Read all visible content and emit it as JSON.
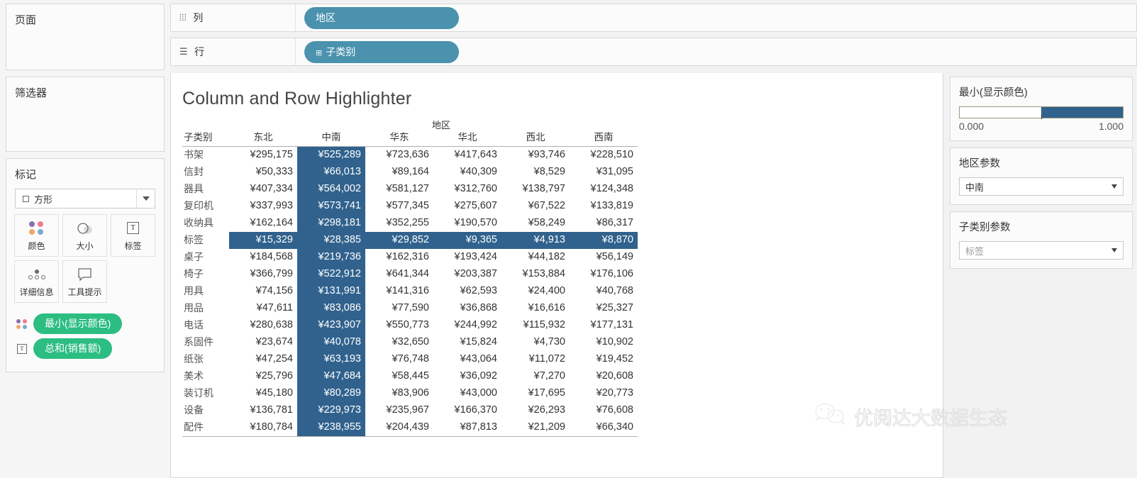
{
  "left_panel": {
    "pages_title": "页面",
    "filters_title": "筛选器",
    "marks_title": "标记",
    "mark_type": "方形",
    "mark_buttons": [
      {
        "label": "颜色",
        "icon": "color-dots-icon"
      },
      {
        "label": "大小",
        "icon": "size-icon"
      },
      {
        "label": "标签",
        "icon": "label-text-icon"
      },
      {
        "label": "详细信息",
        "icon": "detail-dots-icon"
      },
      {
        "label": "工具提示",
        "icon": "tooltip-icon"
      }
    ],
    "mark_pills": [
      {
        "label": "最小(显示颜色)",
        "icon": "color-dots-icon"
      },
      {
        "label": "总和(销售额)",
        "icon": "label-text-icon"
      }
    ]
  },
  "shelves": [
    {
      "name": "columns",
      "label": "列",
      "icon": "columns-icon",
      "pill": "地区",
      "has_expand": false
    },
    {
      "name": "rows",
      "label": "行",
      "icon": "rows-icon",
      "pill": "子类别",
      "has_expand": true
    }
  ],
  "viz": {
    "title": "Column and Row Highlighter",
    "field_header": "地区",
    "row_header": "子类别",
    "columns": [
      "东北",
      "中南",
      "华东",
      "华北",
      "西北",
      "西南"
    ],
    "highlighted_column": "中南",
    "highlighted_row": "标签",
    "rows": [
      {
        "label": "书架",
        "values": [
          "¥295,175",
          "¥525,289",
          "¥723,636",
          "¥417,643",
          "¥93,746",
          "¥228,510"
        ]
      },
      {
        "label": "信封",
        "values": [
          "¥50,333",
          "¥66,013",
          "¥89,164",
          "¥40,309",
          "¥8,529",
          "¥31,095"
        ]
      },
      {
        "label": "器具",
        "values": [
          "¥407,334",
          "¥564,002",
          "¥581,127",
          "¥312,760",
          "¥138,797",
          "¥124,348"
        ]
      },
      {
        "label": "复印机",
        "values": [
          "¥337,993",
          "¥573,741",
          "¥577,345",
          "¥275,607",
          "¥67,522",
          "¥133,819"
        ]
      },
      {
        "label": "收纳具",
        "values": [
          "¥162,164",
          "¥298,181",
          "¥352,255",
          "¥190,570",
          "¥58,249",
          "¥86,317"
        ]
      },
      {
        "label": "标签",
        "values": [
          "¥15,329",
          "¥28,385",
          "¥29,852",
          "¥9,365",
          "¥4,913",
          "¥8,870"
        ]
      },
      {
        "label": "桌子",
        "values": [
          "¥184,568",
          "¥219,736",
          "¥162,316",
          "¥193,424",
          "¥44,182",
          "¥56,149"
        ]
      },
      {
        "label": "椅子",
        "values": [
          "¥366,799",
          "¥522,912",
          "¥641,344",
          "¥203,387",
          "¥153,884",
          "¥176,106"
        ]
      },
      {
        "label": "用具",
        "values": [
          "¥74,156",
          "¥131,991",
          "¥141,316",
          "¥62,593",
          "¥24,400",
          "¥40,768"
        ]
      },
      {
        "label": "用品",
        "values": [
          "¥47,611",
          "¥83,086",
          "¥77,590",
          "¥36,868",
          "¥16,616",
          "¥25,327"
        ]
      },
      {
        "label": "电话",
        "values": [
          "¥280,638",
          "¥423,907",
          "¥550,773",
          "¥244,992",
          "¥115,932",
          "¥177,131"
        ]
      },
      {
        "label": "系固件",
        "values": [
          "¥23,674",
          "¥40,078",
          "¥32,650",
          "¥15,824",
          "¥4,730",
          "¥10,902"
        ]
      },
      {
        "label": "纸张",
        "values": [
          "¥47,254",
          "¥63,193",
          "¥76,748",
          "¥43,064",
          "¥11,072",
          "¥19,452"
        ]
      },
      {
        "label": "美术",
        "values": [
          "¥25,796",
          "¥47,684",
          "¥58,445",
          "¥36,092",
          "¥7,270",
          "¥20,608"
        ]
      },
      {
        "label": "装订机",
        "values": [
          "¥45,180",
          "¥80,289",
          "¥83,906",
          "¥43,000",
          "¥17,695",
          "¥20,773"
        ]
      },
      {
        "label": "设备",
        "values": [
          "¥136,781",
          "¥229,973",
          "¥235,967",
          "¥166,370",
          "¥26,293",
          "¥76,608"
        ]
      },
      {
        "label": "配件",
        "values": [
          "¥180,784",
          "¥238,955",
          "¥204,439",
          "¥87,813",
          "¥21,209",
          "¥66,340"
        ]
      }
    ]
  },
  "right_panel": {
    "legend": {
      "title": "最小(显示颜色)",
      "min": "0.000",
      "max": "1.000"
    },
    "params": [
      {
        "title": "地区参数",
        "value": "中南",
        "dim": false
      },
      {
        "title": "子类别参数",
        "value": "标签",
        "dim": true
      }
    ]
  },
  "watermark": {
    "text": "优阅达大数据生态",
    "icon": "wechat-icon"
  },
  "colors": {
    "highlight_blue": "#31628d",
    "pill_blue": "#4a92ae",
    "pill_green": "#2cbd82",
    "panel_bg": "#f2f2f2",
    "card_bg": "#fbfbfb"
  }
}
